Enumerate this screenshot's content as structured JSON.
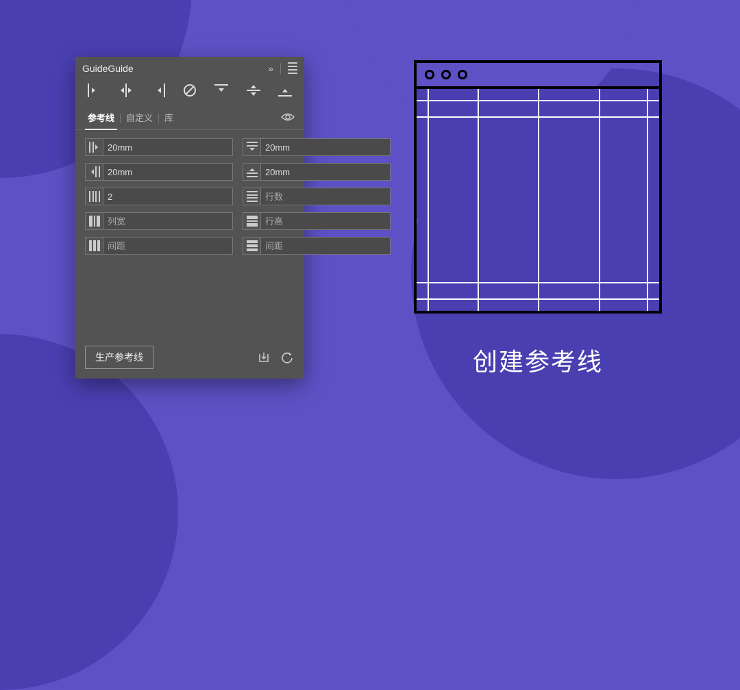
{
  "panel": {
    "title": "GuideGuide",
    "tabs": {
      "guides": "参考线",
      "custom": "自定义",
      "library": "库"
    },
    "fields": {
      "margin_left": {
        "value": "20mm"
      },
      "margin_top": {
        "value": "20mm"
      },
      "margin_right": {
        "value": "20mm"
      },
      "margin_bottom": {
        "value": "20mm"
      },
      "columns": {
        "value": "2"
      },
      "rows": {
        "placeholder": "行数"
      },
      "col_width": {
        "placeholder": "列宽"
      },
      "row_height": {
        "placeholder": "行高"
      },
      "col_gutter": {
        "placeholder": "间距"
      },
      "row_gutter": {
        "placeholder": "间距"
      }
    },
    "make_button": "生产参考线"
  },
  "caption": "创建参考线"
}
